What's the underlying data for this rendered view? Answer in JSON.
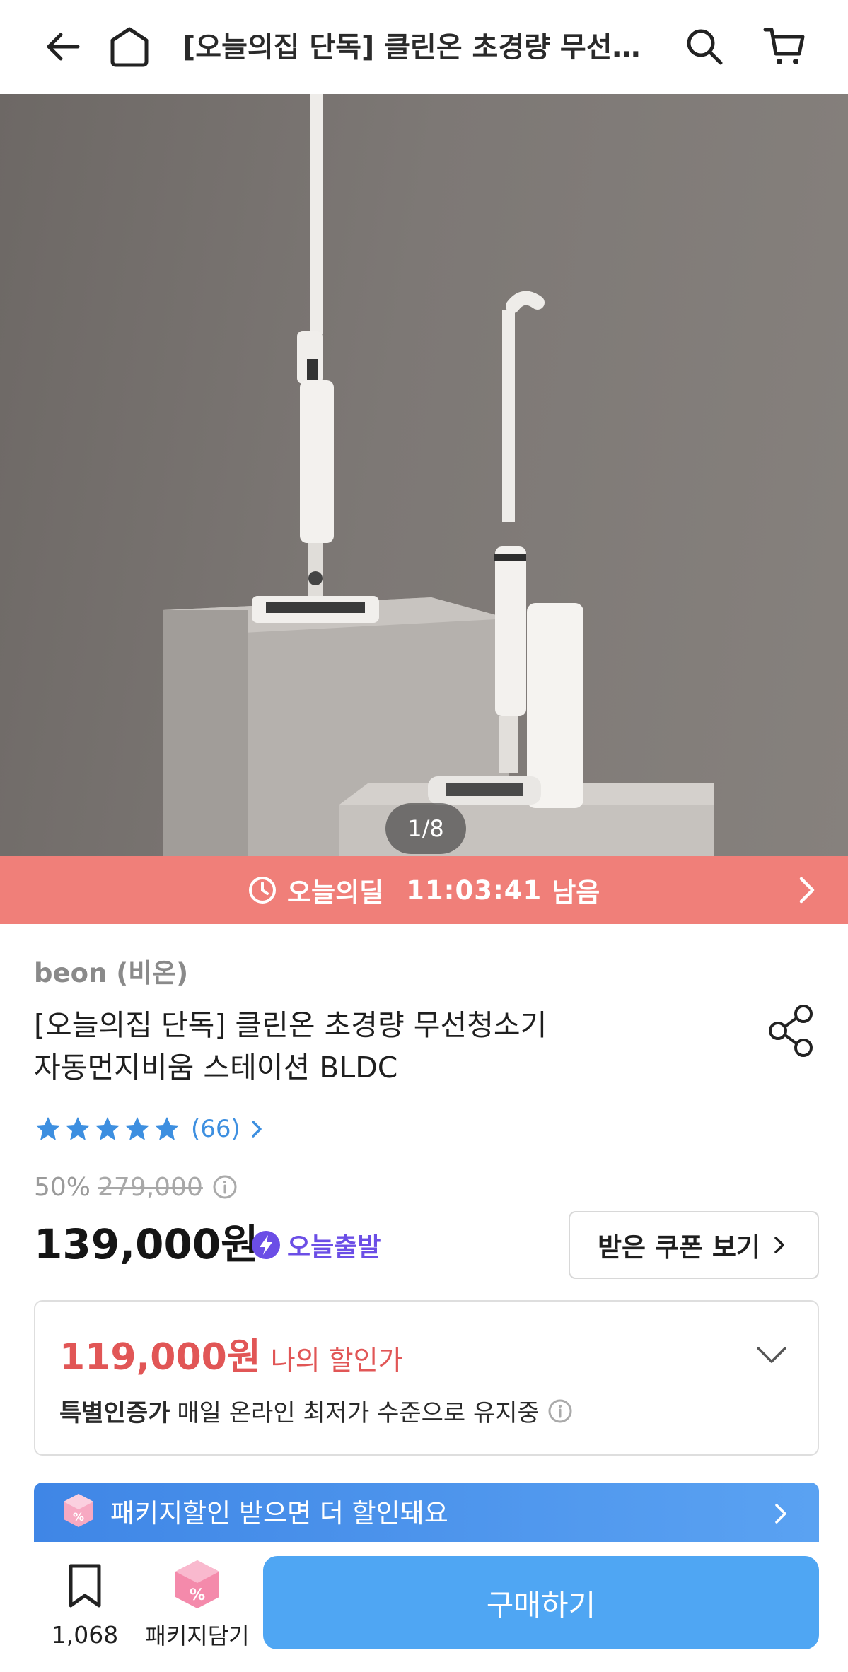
{
  "header": {
    "title": "[오늘의집 단독] 클린온 초경량 무선청소기 자동먼지비움 스테이션 BLDC",
    "icons": [
      "back-arrow-icon",
      "home-icon",
      "search-icon",
      "cart-icon"
    ]
  },
  "gallery": {
    "counter": "1/8"
  },
  "deal_banner": {
    "label": "오늘의딜",
    "time_left": "11:03:41",
    "suffix": "남음",
    "color": "#f07f79"
  },
  "product": {
    "brand": "beon (비온)",
    "title_line1": "[오늘의집 단독] 클린온 초경량 무선청소기",
    "title_line2": "자동먼지비움 스테이션 BLDC",
    "rating": {
      "stars": 5,
      "review_count": "(66)"
    },
    "discount_percent": "50%",
    "original_price": "279,000",
    "price": "139,000원",
    "fast_delivery_label": "오늘출발",
    "coupon_button": "받은 쿠폰 보기"
  },
  "my_price": {
    "value": "119,000원",
    "label": "나의 할인가",
    "note_bold": "특별인증가",
    "note_text": "매일 온라인 최저가 수준으로 유지중"
  },
  "package_banner": {
    "text": "패키지할인 받으면 더 할인돼요"
  },
  "bottom_bar": {
    "bookmark_count": "1,068",
    "package_label": "패키지담기",
    "buy_label": "구매하기"
  },
  "colors": {
    "accent_blue": "#4fa6f3",
    "price_red": "#e15656",
    "today_purple": "#6b4ee6",
    "star_blue": "#3d8fe0"
  }
}
